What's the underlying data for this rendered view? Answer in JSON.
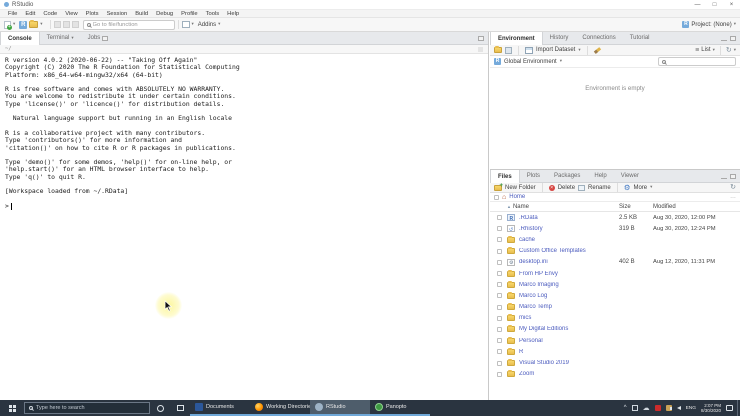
{
  "window": {
    "title": "RStudio",
    "minimize": "—",
    "maximize": "□",
    "close": "×"
  },
  "menu_items": [
    "File",
    "Edit",
    "Code",
    "View",
    "Plots",
    "Session",
    "Build",
    "Debug",
    "Profile",
    "Tools",
    "Help"
  ],
  "main_toolbar": {
    "goto_placeholder": "Go to file/function",
    "addins_label": "Addins",
    "project_label": "Project: (None)"
  },
  "console_pane": {
    "tabs": [
      "Console",
      "Terminal",
      "Jobs"
    ],
    "path": "~/",
    "lines": [
      "R version 4.0.2 (2020-06-22) -- \"Taking Off Again\"",
      "Copyright (C) 2020 The R Foundation for Statistical Computing",
      "Platform: x86_64-w64-mingw32/x64 (64-bit)",
      "",
      "R is free software and comes with ABSOLUTELY NO WARRANTY.",
      "You are welcome to redistribute it under certain conditions.",
      "Type 'license()' or 'licence()' for distribution details.",
      "",
      "  Natural language support but running in an English locale",
      "",
      "R is a collaborative project with many contributors.",
      "Type 'contributors()' for more information and",
      "'citation()' on how to cite R or R packages in publications.",
      "",
      "Type 'demo()' for some demos, 'help()' for on-line help, or",
      "'help.start()' for an HTML browser interface to help.",
      "Type 'q()' to quit R.",
      "",
      "[Workspace loaded from ~/.RData]",
      ""
    ],
    "prompt": ">"
  },
  "environment_pane": {
    "tabs": [
      "Environment",
      "History",
      "Connections",
      "Tutorial"
    ],
    "toolbar": {
      "import_dataset": "Import Dataset",
      "list": "List"
    },
    "scope": "Global Environment",
    "empty_message": "Environment is empty"
  },
  "files_pane": {
    "tabs": [
      "Files",
      "Plots",
      "Packages",
      "Help",
      "Viewer"
    ],
    "toolbar": {
      "new_folder": "New Folder",
      "delete": "Delete",
      "rename": "Rename",
      "more": "More"
    },
    "breadcrumb": "Home",
    "columns": {
      "name": "Name",
      "size": "Size",
      "modified": "Modified"
    },
    "files": [
      {
        "name": ".RData",
        "type": "rdata",
        "size": "2.5 KB",
        "modified": "Aug 30, 2020, 12:00 PM"
      },
      {
        "name": ".Rhistory",
        "type": "rhistory",
        "size": "319 B",
        "modified": "Aug 30, 2020, 12:24 PM"
      },
      {
        "name": "cache",
        "type": "folder",
        "size": "",
        "modified": ""
      },
      {
        "name": "Custom Office Templates",
        "type": "folder",
        "size": "",
        "modified": ""
      },
      {
        "name": "desktop.ini",
        "type": "ini",
        "size": "402 B",
        "modified": "Aug 12, 2020, 11:31 PM"
      },
      {
        "name": "From HP Envy",
        "type": "folder",
        "size": "",
        "modified": ""
      },
      {
        "name": "Marco Imaging",
        "type": "folder",
        "size": "",
        "modified": ""
      },
      {
        "name": "Marco Log",
        "type": "folder",
        "size": "",
        "modified": ""
      },
      {
        "name": "Marco Temp",
        "type": "folder",
        "size": "",
        "modified": ""
      },
      {
        "name": "mics",
        "type": "folder",
        "size": "",
        "modified": ""
      },
      {
        "name": "My Digital Editions",
        "type": "folder",
        "size": "",
        "modified": ""
      },
      {
        "name": "Personal",
        "type": "folder",
        "size": "",
        "modified": ""
      },
      {
        "name": "R",
        "type": "folder",
        "size": "",
        "modified": ""
      },
      {
        "name": "Visual Studio 2019",
        "type": "folder",
        "size": "",
        "modified": ""
      },
      {
        "name": "Zoom",
        "type": "folder",
        "size": "",
        "modified": ""
      }
    ]
  },
  "taskbar": {
    "search_placeholder": "Type here to search",
    "apps": [
      {
        "label": "Documents",
        "icon": "word"
      },
      {
        "label": "Working Directorie...",
        "icon": "firefox"
      },
      {
        "label": "RStudio",
        "icon": "rstudio",
        "active": true
      },
      {
        "label": "Panopto",
        "icon": "panopto"
      }
    ],
    "language": "ENG",
    "time": "2:07 PM",
    "date": "8/30/2020"
  },
  "colors": {
    "link_blue": "#4b5bbe",
    "folder_yellow": "#f2ce60",
    "taskbar_bg": "#2a3440",
    "taskbar_active": "#4e5d6b",
    "delete_red": "#d64541",
    "run_green": "#3fa53f"
  }
}
